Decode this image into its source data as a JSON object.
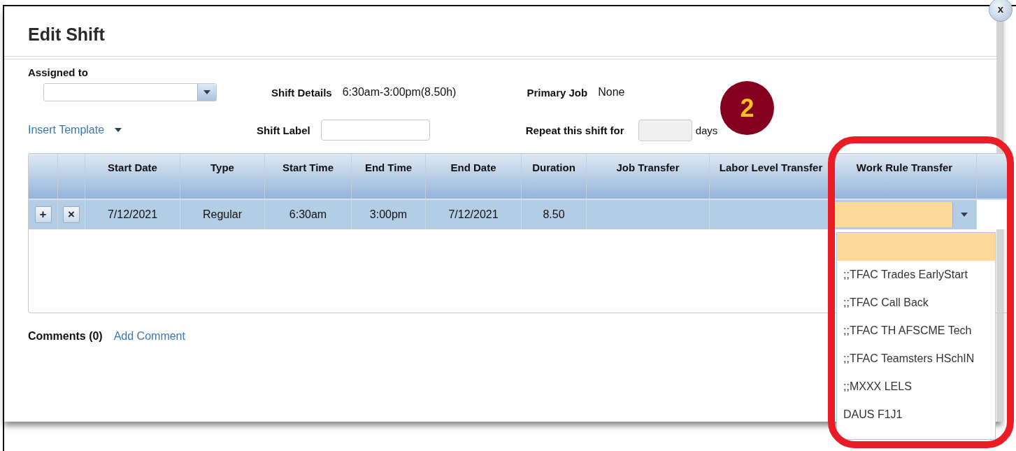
{
  "dialog": {
    "title": "Edit Shift",
    "close_button": "x"
  },
  "form": {
    "assigned_to": {
      "label": "Assigned to"
    },
    "shift_details": {
      "label": "Shift Details",
      "value": "6:30am-3:00pm(8.50h)"
    },
    "primary_job": {
      "label": "Primary Job",
      "value": "None"
    },
    "insert_template": {
      "label": "Insert Template"
    },
    "shift_label": {
      "label": "Shift Label"
    },
    "repeat": {
      "label": "Repeat this shift for",
      "unit": "days"
    }
  },
  "table": {
    "columns": [
      null,
      null,
      "Start Date",
      "Type",
      "Start Time",
      "End Time",
      "End Date",
      "Duration",
      "Job Transfer",
      "Labor Level Transfer",
      "Work Rule Transfer"
    ],
    "rows": [
      {
        "selected": true,
        "cells": [
          {
            "kind": "add_button",
            "value": "+"
          },
          {
            "kind": "remove_button",
            "value": "×"
          },
          {
            "kind": "text",
            "value": "7/12/2021"
          },
          {
            "kind": "text",
            "value": "Regular"
          },
          {
            "kind": "text",
            "value": "6:30am"
          },
          {
            "kind": "text",
            "value": "3:00pm"
          },
          {
            "kind": "text",
            "value": "7/12/2021"
          },
          {
            "kind": "text",
            "value": "8.50"
          },
          {
            "kind": "blank"
          },
          {
            "kind": "blank"
          },
          {
            "kind": "select"
          }
        ]
      }
    ]
  },
  "comments": {
    "label": "Comments (0)",
    "link": "Add Comment"
  },
  "dropdown": {
    "blank_option_highlighted": true,
    "options": [
      {
        "label": ";;TFAC Trades EarlyStart",
        "selected": false
      },
      {
        "label": ";;TFAC Call Back",
        "selected": false
      },
      {
        "label": ";;TFAC TH AFSCME Tech",
        "selected": false
      },
      {
        "label": ";;TFAC Teamsters HSchIN",
        "selected": false
      },
      {
        "label": ";;MXXX LELS",
        "selected": false
      },
      {
        "label": "DAUS F1J1",
        "selected": false
      }
    ]
  },
  "step_badge": "2"
}
